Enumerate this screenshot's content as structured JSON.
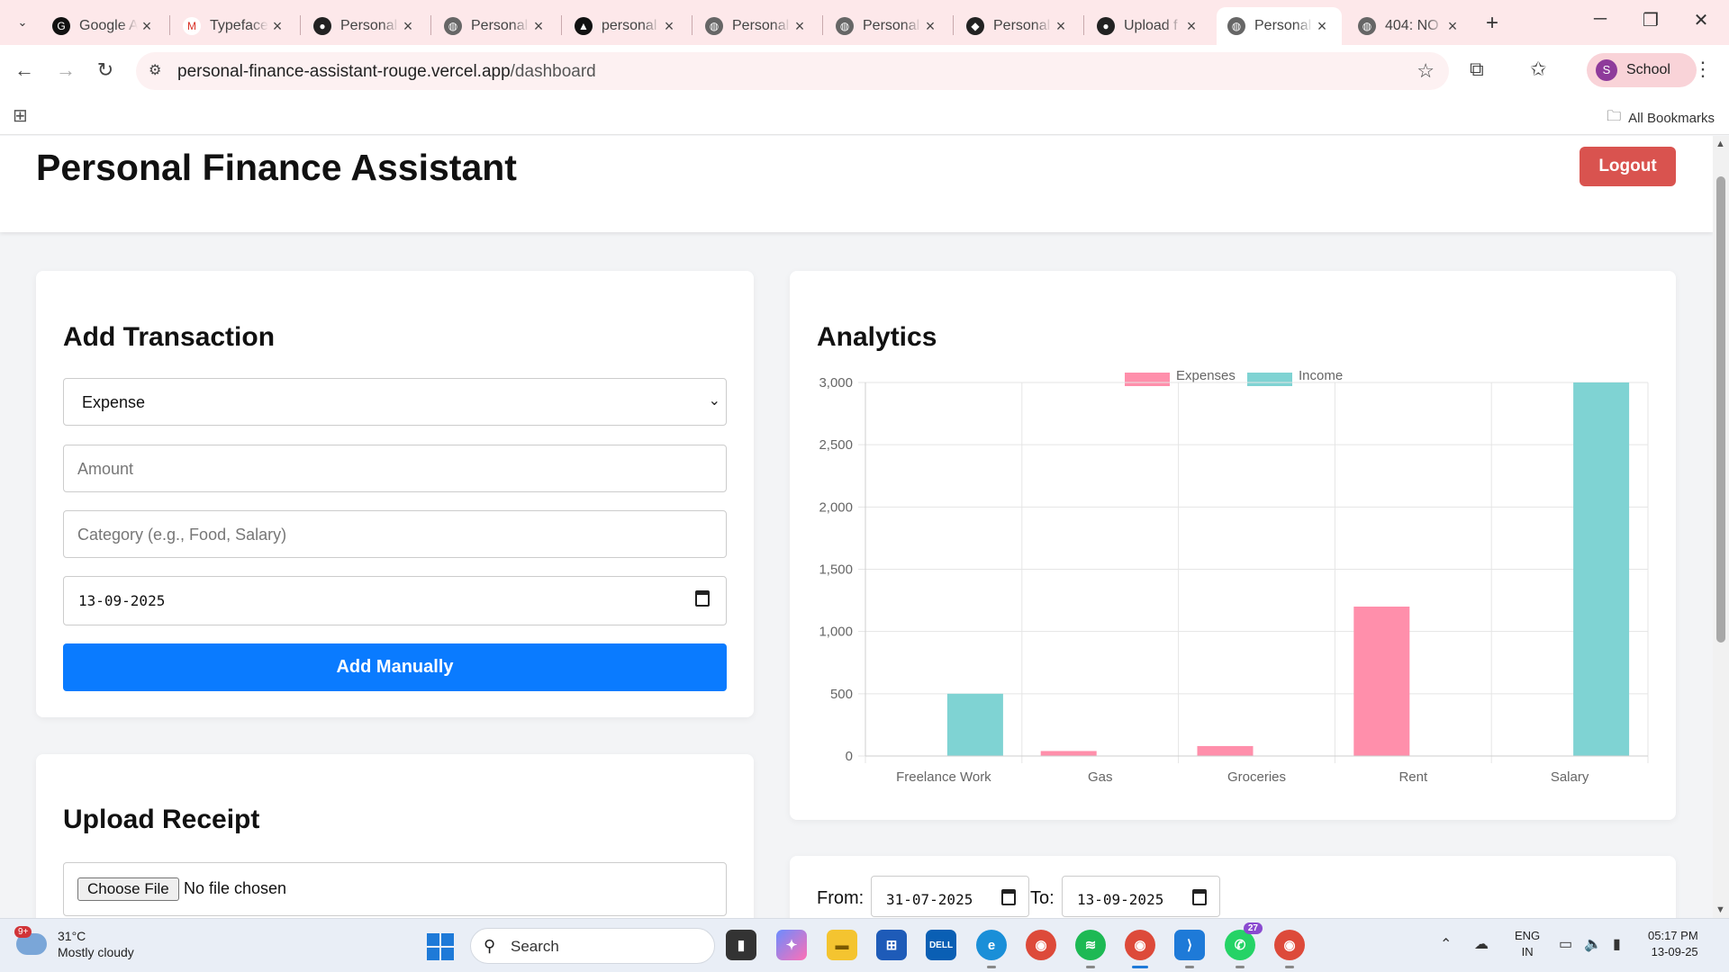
{
  "browser": {
    "tabs": [
      {
        "label": "Google Ai",
        "icon": "google-ai-icon",
        "active": false
      },
      {
        "label": "Typeface",
        "icon": "gmail-icon",
        "active": false
      },
      {
        "label": "Personal",
        "icon": "github-icon",
        "active": false
      },
      {
        "label": "Personal",
        "icon": "globe-icon",
        "active": false
      },
      {
        "label": "personal",
        "icon": "vercel-icon",
        "active": false
      },
      {
        "label": "Personal",
        "icon": "globe-icon",
        "active": false
      },
      {
        "label": "Personal",
        "icon": "globe-icon",
        "active": false
      },
      {
        "label": "Personal",
        "icon": "render-icon",
        "active": false
      },
      {
        "label": "Upload f",
        "icon": "github-icon",
        "active": false
      },
      {
        "label": "Personal",
        "icon": "globe-icon",
        "active": true
      },
      {
        "label": "404: NO",
        "icon": "globe-icon",
        "active": false
      }
    ],
    "url_host": "personal-finance-assistant-rouge.vercel.app",
    "url_path": "/dashboard",
    "profile_initial": "S",
    "profile_name": "School",
    "bookmarks_label": "All Bookmarks"
  },
  "app": {
    "title": "Personal Finance Assistant",
    "logout_label": "Logout"
  },
  "add_transaction": {
    "title": "Add Transaction",
    "type_selected": "Expense",
    "amount_placeholder": "Amount",
    "category_placeholder": "Category (e.g., Food, Salary)",
    "date_value": "13-09-2025",
    "submit_label": "Add Manually"
  },
  "upload_receipt": {
    "title": "Upload Receipt",
    "choose_label": "Choose File",
    "no_file_label": "No file chosen"
  },
  "analytics": {
    "title": "Analytics"
  },
  "filter": {
    "from_label": "From:",
    "from_value": "31-07-2025",
    "to_label": "To:",
    "to_value": "13-09-2025"
  },
  "chart_data": {
    "type": "bar",
    "categories": [
      "Freelance Work",
      "Gas",
      "Groceries",
      "Rent",
      "Salary"
    ],
    "series": [
      {
        "name": "Expenses",
        "values": [
          0,
          40,
          80,
          1200,
          0
        ],
        "color": "#ff8fab"
      },
      {
        "name": "Income",
        "values": [
          500,
          0,
          0,
          0,
          3000
        ],
        "color": "#7fd3d3"
      }
    ],
    "ylim": [
      0,
      3000
    ],
    "yticks": [
      "0",
      "500",
      "1,000",
      "1,500",
      "2,000",
      "2,500",
      "3,000"
    ],
    "grid": true,
    "legend": "top-center"
  },
  "taskbar": {
    "weather_temp": "31°C",
    "weather_desc": "Mostly cloudy",
    "weather_badge": "9+",
    "search_label": "Search",
    "whatsapp_badge": "27",
    "lang_line1": "ENG",
    "lang_line2": "IN",
    "time": "05:17 PM",
    "date": "13-09-25"
  }
}
